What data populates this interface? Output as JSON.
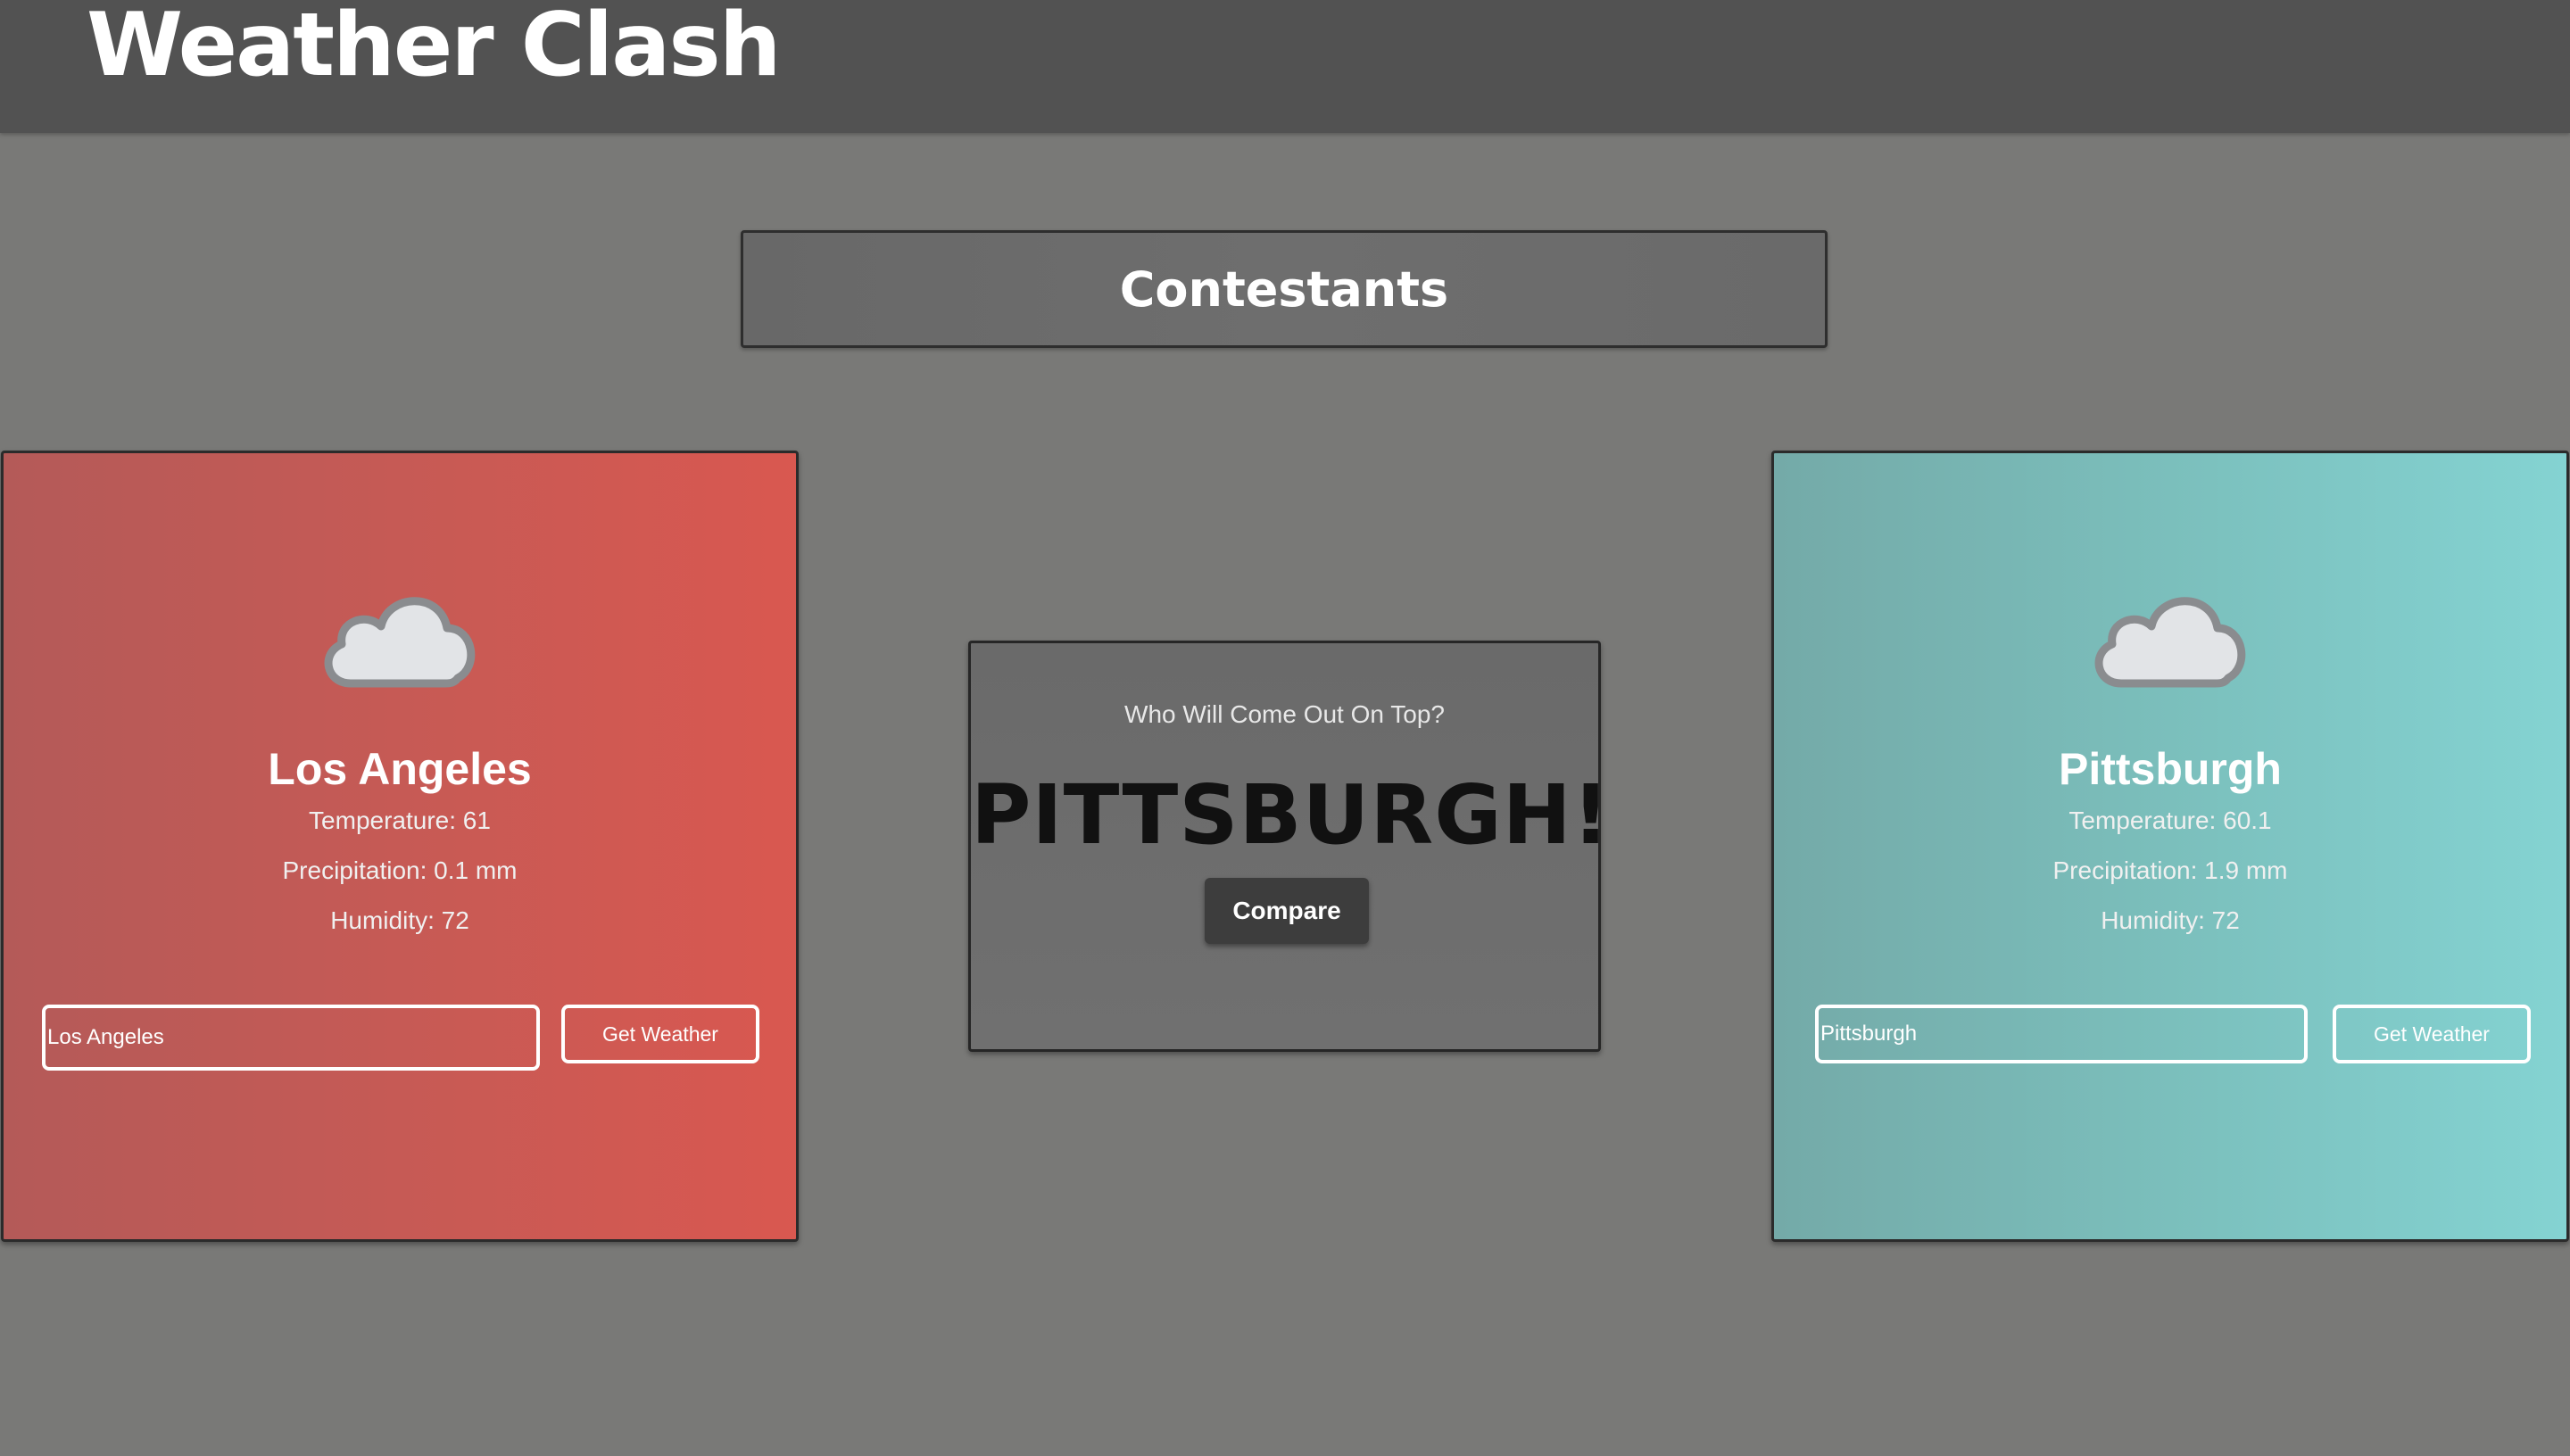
{
  "app": {
    "title": "Weather Clash"
  },
  "banner": {
    "label": "Contestants"
  },
  "left_city": {
    "name": "Los Angeles",
    "temperature": "Temperature: 61",
    "precipitation": "Precipitation: 0.1 mm",
    "humidity": "Humidity: 72",
    "input_value": "Los Angeles",
    "button_label": "Get Weather",
    "icon": "cloud-icon",
    "color": "#d05a53"
  },
  "right_city": {
    "name": "Pittsburgh",
    "temperature": "Temperature: 60.1",
    "precipitation": "Precipitation: 1.9 mm",
    "humidity": "Humidity: 72",
    "input_value": "Pittsburgh",
    "button_label": "Get Weather",
    "icon": "cloud-icon",
    "color": "#7cc4c2"
  },
  "compare": {
    "question": "Who Will Come Out On Top?",
    "winner": "PITTSBURGH!",
    "button_label": "Compare"
  }
}
